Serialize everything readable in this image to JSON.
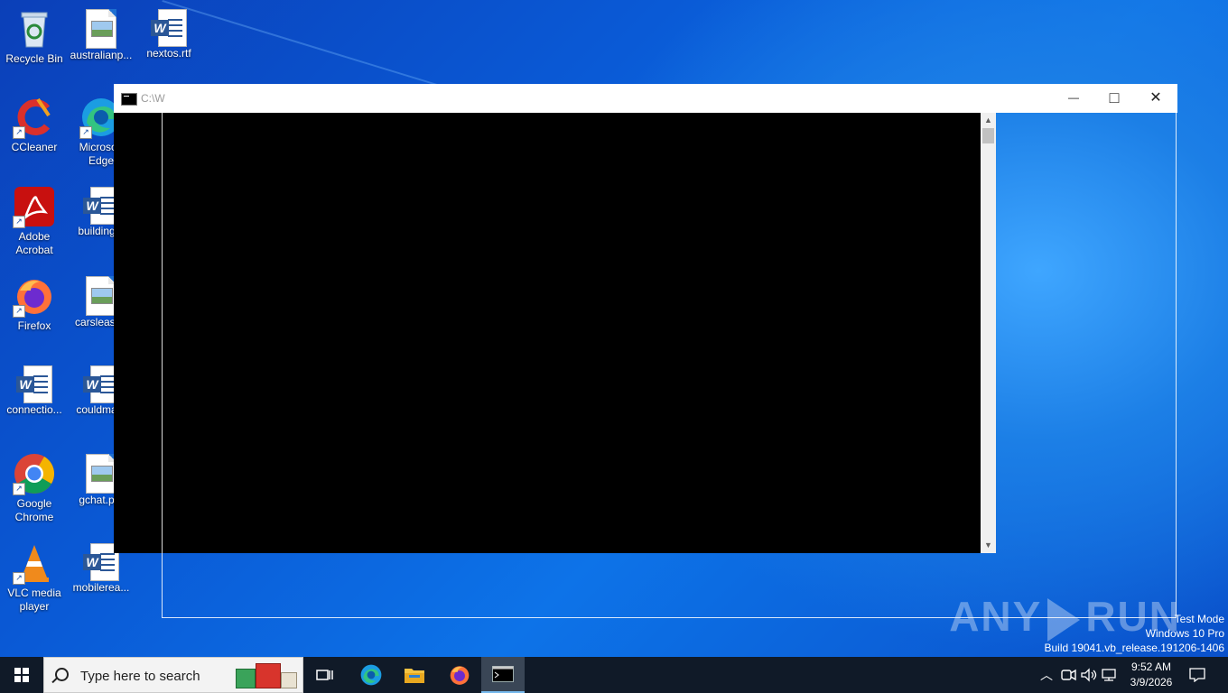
{
  "desktop": {
    "icons": [
      {
        "label": "Recycle Bin",
        "icon": "recycle-bin-icon"
      },
      {
        "label": "australianp...",
        "icon": "image-file-icon"
      },
      {
        "label": "nextos.rtf",
        "icon": "word-doc-icon"
      },
      {
        "label": "CCleaner",
        "icon": "ccleaner-icon"
      },
      {
        "label": "Microsoft Edge",
        "icon": "edge-icon"
      },
      {
        "label": "Adobe Acrobat",
        "icon": "acrobat-icon"
      },
      {
        "label": "building...",
        "icon": "word-doc-icon"
      },
      {
        "label": "Firefox",
        "icon": "firefox-icon"
      },
      {
        "label": "carsleast...",
        "icon": "image-file-icon"
      },
      {
        "label": "connectio...",
        "icon": "word-doc-icon"
      },
      {
        "label": "couldma...",
        "icon": "word-doc-icon"
      },
      {
        "label": "Google Chrome",
        "icon": "chrome-icon"
      },
      {
        "label": "gchat.p...",
        "icon": "image-file-icon"
      },
      {
        "label": "VLC media player",
        "icon": "vlc-icon"
      },
      {
        "label": "mobilerea...",
        "icon": "word-doc-icon"
      }
    ]
  },
  "console_window": {
    "title": "C:\\W",
    "minimize_glyph": "—",
    "maximize_glyph": "□",
    "close_glyph": "✕"
  },
  "watermark": {
    "left": "ANY",
    "right": "RUN"
  },
  "system_info": {
    "line1": "Test Mode",
    "line2": "Windows 10 Pro",
    "line3": "Build 19041.vb_release.191206-1406"
  },
  "taskbar": {
    "search_placeholder": "Type here to search",
    "items": [
      "task-view",
      "edge",
      "file-explorer",
      "firefox",
      "cmd"
    ],
    "clock_time": "9:52 AM",
    "clock_date": "3/9/2026"
  },
  "colors": {
    "desktop_blue": "#0a5ad6",
    "taskbar": "#101a28",
    "console_bg": "#000000"
  }
}
